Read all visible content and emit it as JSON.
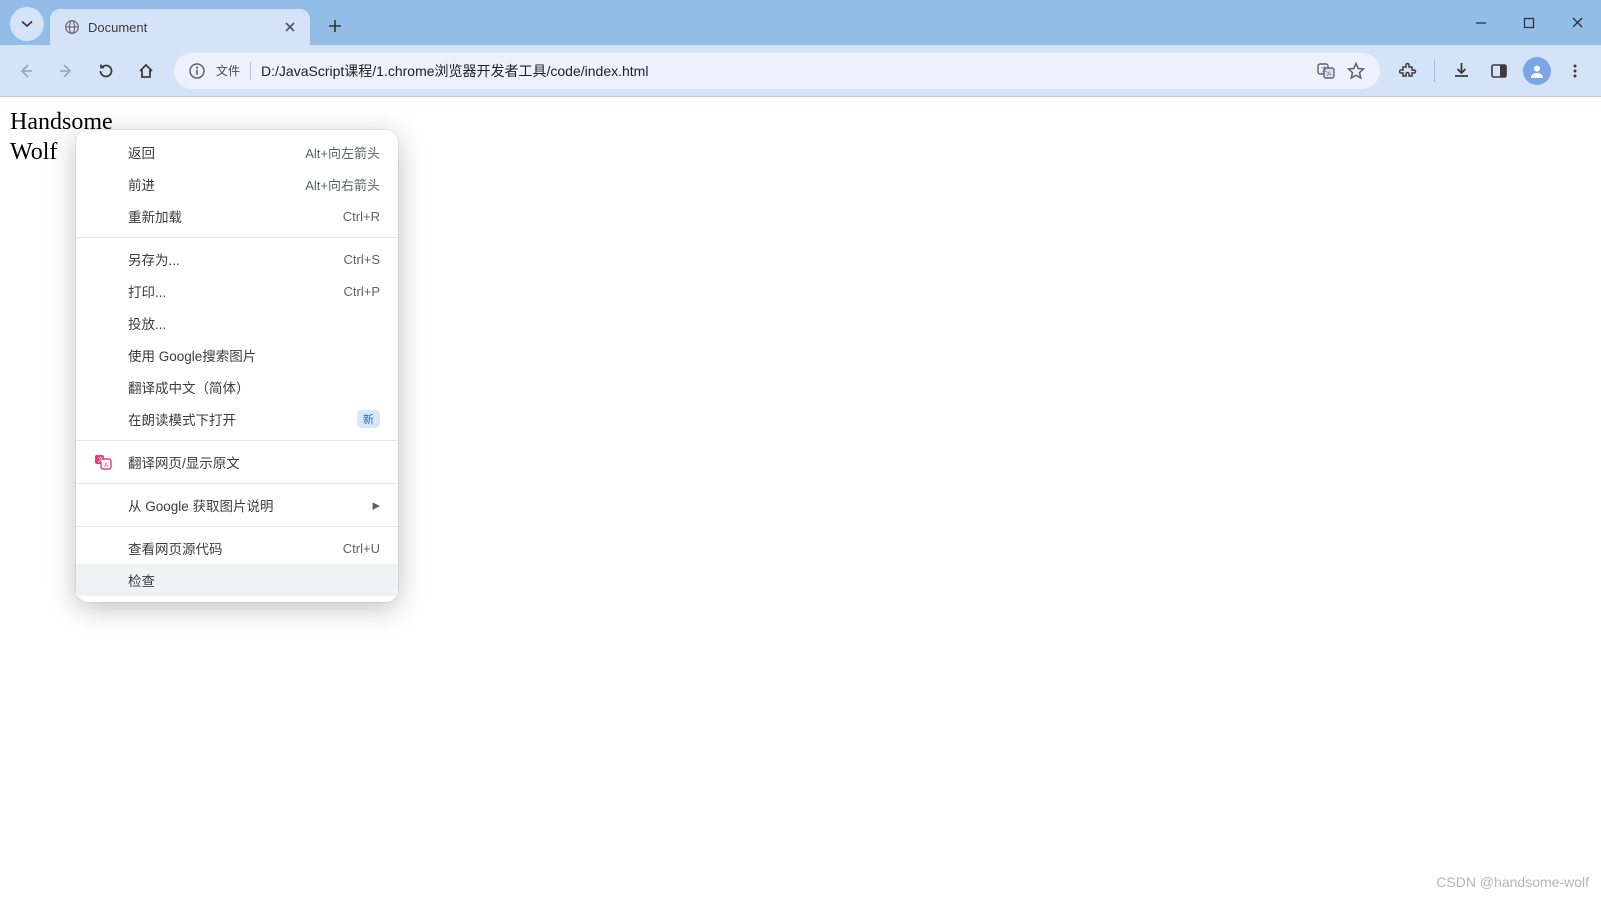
{
  "tab": {
    "title": "Document"
  },
  "omnibox": {
    "file_label": "文件",
    "url": "D:/JavaScript课程/1.chrome浏览器开发者工具/code/index.html"
  },
  "page": {
    "line1": "Handsome",
    "line2": "Wolf"
  },
  "menu": {
    "back": {
      "label": "返回",
      "short": "Alt+向左箭头"
    },
    "forward": {
      "label": "前进",
      "short": "Alt+向右箭头"
    },
    "reload": {
      "label": "重新加载",
      "short": "Ctrl+R"
    },
    "save_as": {
      "label": "另存为...",
      "short": "Ctrl+S"
    },
    "print": {
      "label": "打印...",
      "short": "Ctrl+P"
    },
    "cast": {
      "label": "投放..."
    },
    "search_img": {
      "label": "使用 Google搜索图片"
    },
    "translate_zh": {
      "label": "翻译成中文（简体）"
    },
    "reader": {
      "label": "在朗读模式下打开",
      "badge": "新"
    },
    "translate_pg": {
      "label": "翻译网页/显示原文"
    },
    "img_desc": {
      "label": "从 Google 获取图片说明"
    },
    "view_source": {
      "label": "查看网页源代码",
      "short": "Ctrl+U"
    },
    "inspect": {
      "label": "检查"
    }
  },
  "watermark": "CSDN @handsome-wolf"
}
